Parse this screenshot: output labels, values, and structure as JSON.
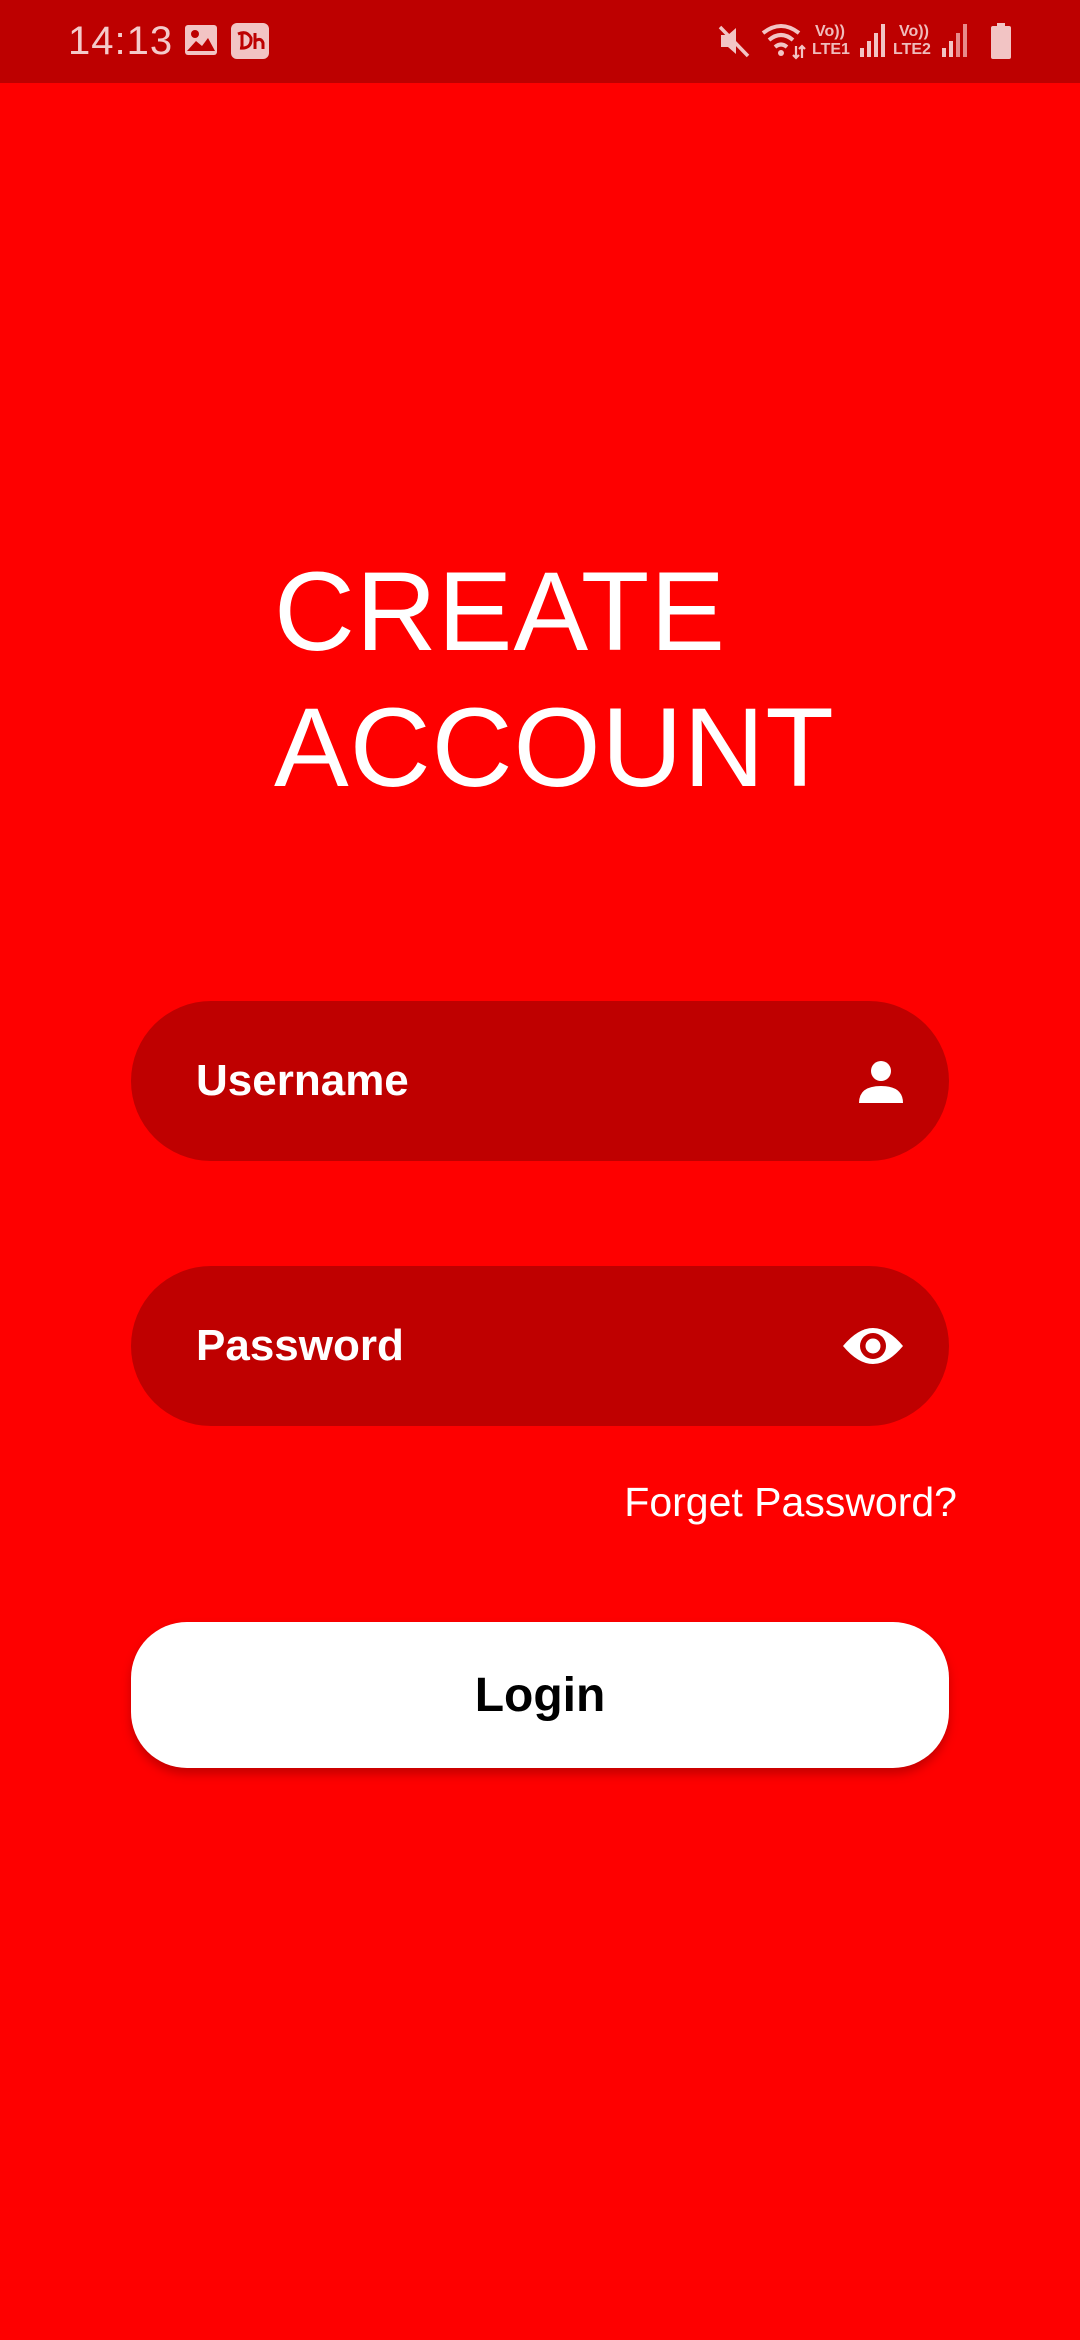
{
  "status_bar": {
    "time": "14:13",
    "icons": [
      "gallery-notification-icon",
      "app-notification-icon",
      "mute-icon",
      "wifi-icon",
      "signal-sim1-icon",
      "signal-sim2-icon",
      "battery-icon"
    ],
    "sim1_volte": "Vo))",
    "sim1_network": "LTE1",
    "sim2_volte": "Vo))",
    "sim2_network": "LTE2"
  },
  "title": {
    "line1": "CREATE",
    "line2": "ACCOUNT"
  },
  "form": {
    "username_placeholder": "Username",
    "username_value": "",
    "username_icon": "person-icon",
    "password_placeholder": "Password",
    "password_value": "",
    "password_icon": "eye-icon",
    "forgot_password_label": "Forget Password?",
    "login_label": "Login"
  },
  "colors": {
    "background": "#fe0000",
    "status_bar": "#bd0000",
    "field_background": "#bf0000",
    "button_background": "#ffffff",
    "text_light": "#ffffff",
    "text_dark": "#000000"
  }
}
